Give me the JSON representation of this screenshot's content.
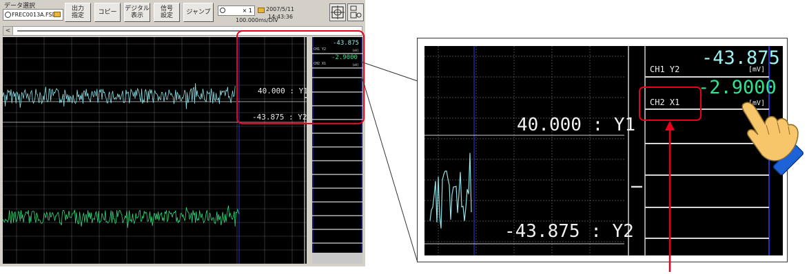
{
  "toolbar": {
    "data_select_label": "データ選択",
    "file_name": "FREC0013A.FSD",
    "buttons": [
      {
        "label": "出力\n指定"
      },
      {
        "label": "コピー"
      },
      {
        "label": "デジタル\n表示"
      },
      {
        "label": "信号\n設定"
      },
      {
        "label": "ジャンプ"
      }
    ],
    "zoom_value": "× 1",
    "time_div": "100.000ms/DIV",
    "date": "2007/5/11",
    "time": "14:43:36"
  },
  "scroll": {
    "left_arrow": "<"
  },
  "cursor": {
    "y1_label": "40.000 : Y1",
    "y2_label": "-43.875 : Y2"
  },
  "channels": [
    {
      "name": "CH1 Y2",
      "value": "-43.875",
      "unit": "[mV]",
      "color": "#9ff0f0"
    },
    {
      "name": "CH2 X1",
      "value": "-2.9000",
      "unit": "[mV]",
      "color": "#33e090"
    }
  ],
  "colors": {
    "wave1": "#8fe3e8",
    "wave2": "#2fdc80",
    "cursor_line": "#2233cc",
    "highlight": "#e8001c",
    "hand": "#f7c56a",
    "cuff": "#1e62d8"
  },
  "icons": [
    "clock-icon",
    "folder-icon",
    "cursor-icon",
    "settings-icon",
    "pointing-hand-icon"
  ]
}
